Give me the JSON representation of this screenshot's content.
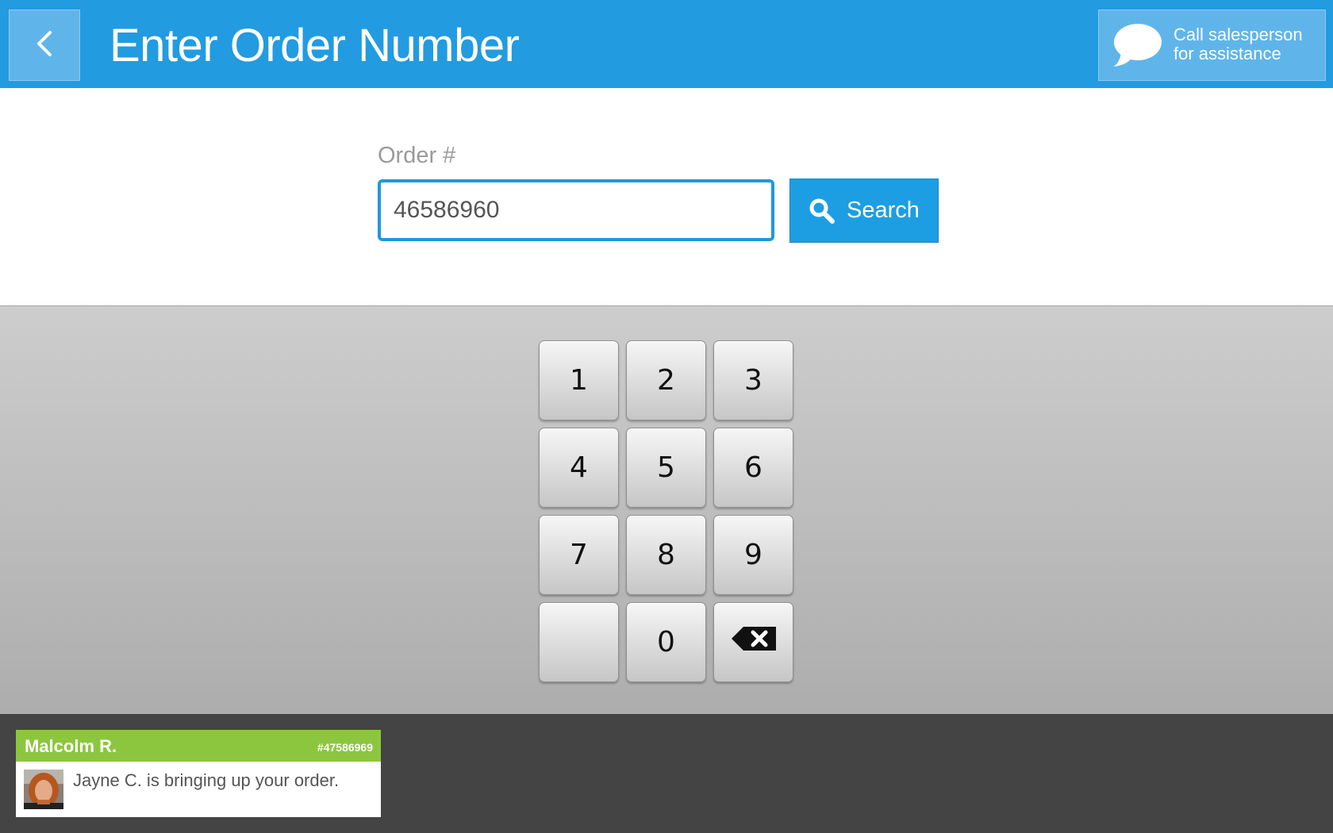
{
  "header": {
    "title": "Enter Order Number",
    "back_icon": "chevron-left-icon",
    "assist_icon": "speech-bubble-icon",
    "assist_line1": "Call salesperson",
    "assist_line2": "for assistance"
  },
  "order": {
    "label": "Order #",
    "value": "46586960",
    "search_label": "Search",
    "search_icon": "search-icon"
  },
  "keypad": {
    "keys": [
      "1",
      "2",
      "3",
      "4",
      "5",
      "6",
      "7",
      "8",
      "9",
      "",
      "0"
    ],
    "backspace_icon": "backspace-icon"
  },
  "notification": {
    "name": "Malcolm R.",
    "order_ref": "#47586969",
    "message": "Jayne C. is bringing up your order.",
    "avatar_icon": "avatar"
  },
  "colors": {
    "header_blue": "#229be0",
    "accent_blue": "#1d9ee2",
    "notification_green": "#8cc63e",
    "bottom_bar": "#444444"
  }
}
